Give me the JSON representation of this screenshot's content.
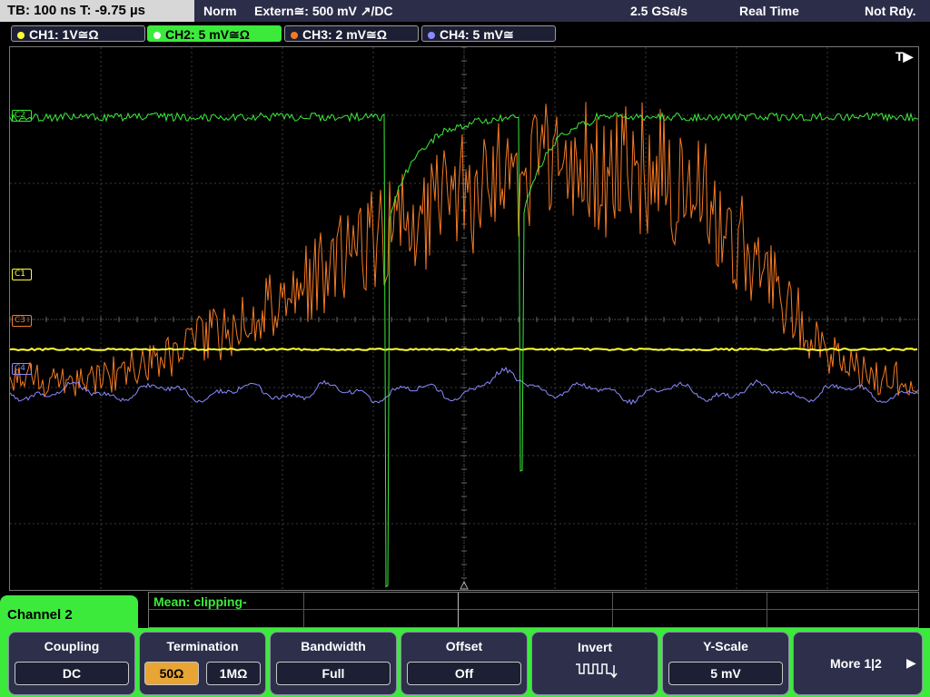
{
  "status": {
    "timebase": "TB: 100 ns   T: -9.75 µs",
    "trigger_mode": "Norm",
    "trigger_source": "Extern≅: 500 mV ↗/DC",
    "sample_rate": "2.5 GSa/s",
    "acq_mode": "Real Time",
    "state": "Not Rdy."
  },
  "channels": [
    {
      "label": "CH1: 1V≅Ω",
      "color": "#ffff33"
    },
    {
      "label": "CH2: 5 mV≅Ω",
      "color": "#3cea3c"
    },
    {
      "label": "CH3: 2 mV≅Ω",
      "color": "#f47a24"
    },
    {
      "label": "CH4: 5 mV≅",
      "color": "#8a8aff"
    }
  ],
  "markers": {
    "trigger": "T▶",
    "c1": "C1",
    "c3": "C3",
    "c4": "C4",
    "c2": "C2"
  },
  "measurement": {
    "text": "Mean: clipping-"
  },
  "menu": {
    "channel_title": "Channel 2",
    "coupling": {
      "title": "Coupling",
      "value": "DC"
    },
    "termination": {
      "title": "Termination",
      "opt1": "50Ω",
      "opt2": "1MΩ"
    },
    "bandwidth": {
      "title": "Bandwidth",
      "value": "Full"
    },
    "offset": {
      "title": "Offset",
      "value": "Off"
    },
    "invert": {
      "title": "Invert",
      "icon": "inverted-pulse-icon"
    },
    "yscale": {
      "title": "Y-Scale",
      "value": "5 mV"
    },
    "more": {
      "label": "More 1|2",
      "arrow": "▶"
    }
  },
  "colors": {
    "accent": "#3cea3c",
    "background": "#000000",
    "panel": "#2d2f4b",
    "ch1": "#ffff33",
    "ch2": "#3cea3c",
    "ch3": "#f47a24",
    "ch4": "#8a8aff",
    "selected": "#e8a534"
  }
}
